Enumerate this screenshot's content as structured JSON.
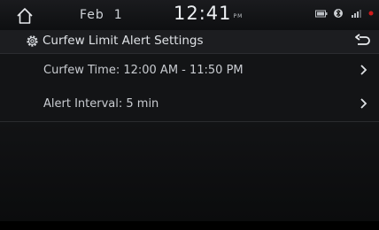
{
  "status_bar": {
    "date": "Feb  1",
    "time": "12:41",
    "ampm": "PM",
    "icons": [
      "battery-icon",
      "bluetooth-icon",
      "signal-icon",
      "record-indicator-icon"
    ]
  },
  "title_bar": {
    "title": "Curfew Limit Alert Settings",
    "icon": "gear-icon",
    "back_icon": "back-arrow-icon"
  },
  "settings": [
    {
      "label": "Curfew Time: 12:00 AM - 11:50 PM",
      "icon": "chevron-right-icon"
    },
    {
      "label": "Alert Interval: 5 min",
      "icon": "chevron-right-icon"
    }
  ],
  "colors": {
    "background": "#111214",
    "text": "#c9ccd1",
    "accent_red": "#d11a1a"
  }
}
